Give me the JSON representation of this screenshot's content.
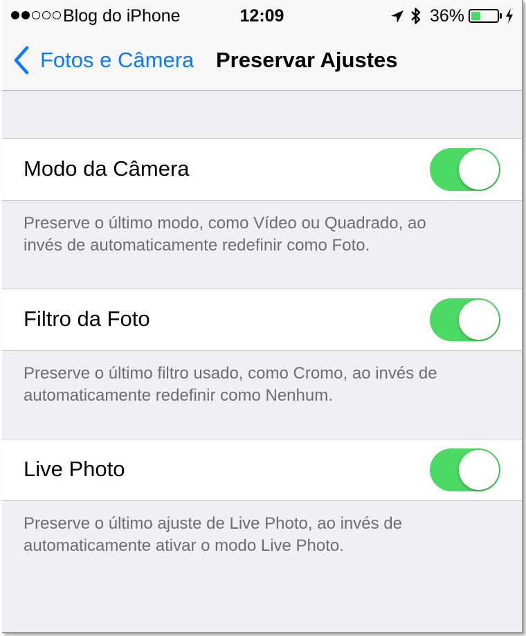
{
  "status_bar": {
    "carrier": "Blog do iPhone",
    "signal_bars_filled": 2,
    "signal_bars_total": 5,
    "time": "12:09",
    "battery_percent": "36%",
    "battery_level": 0.36,
    "icons": [
      "location-arrow-icon",
      "bluetooth-icon",
      "battery-icon",
      "charging-bolt-icon"
    ]
  },
  "nav": {
    "back_label": "Fotos e Câmera",
    "title": "Preservar Ajustes"
  },
  "settings": [
    {
      "label": "Modo da Câmera",
      "on": true,
      "footer_line1": "Preserve o último modo, como Vídeo ou Quadrado, ao",
      "footer_line2": "invés de automaticamente redefinir como Foto."
    },
    {
      "label": "Filtro da Foto",
      "on": true,
      "footer_line1": "Preserve o último filtro usado, como Cromo, ao invés de",
      "footer_line2": "automaticamente redefinir como Nenhum."
    },
    {
      "label": "Live Photo",
      "on": true,
      "footer_line1": "Preserve o último ajuste de Live Photo, ao invés de",
      "footer_line2": "automaticamente ativar o modo Live Photo."
    }
  ],
  "colors": {
    "accent": "#0a7aff",
    "switch_on": "#4cd964",
    "background": "#efeff4",
    "footer_text": "#6d6d72"
  }
}
